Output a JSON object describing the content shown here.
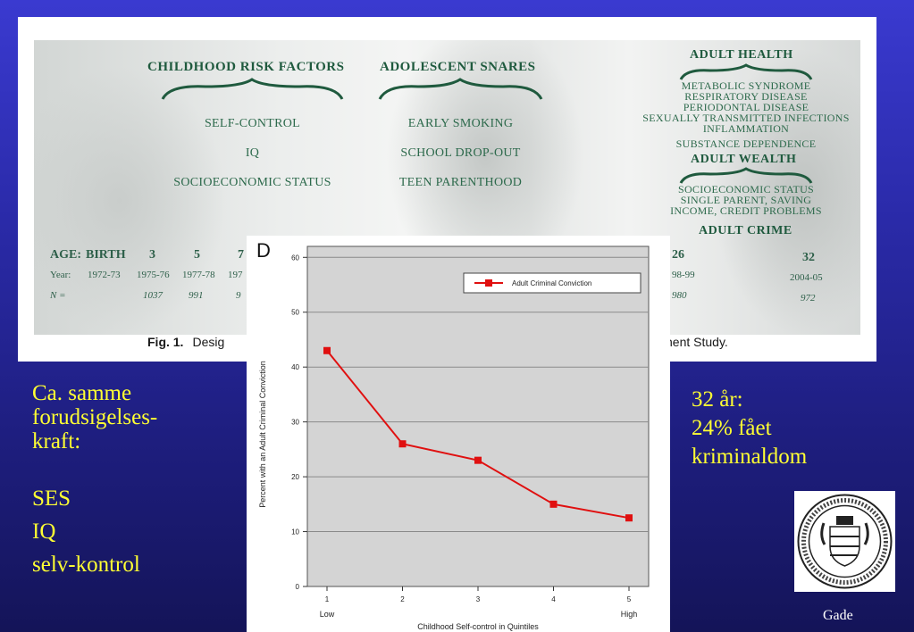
{
  "figure": {
    "childhood": {
      "header": "CHILDHOOD RISK FACTORS",
      "items": [
        "SELF-CONTROL",
        "IQ",
        "SOCIOECONOMIC STATUS"
      ]
    },
    "adolescent": {
      "header": "ADOLESCENT SNARES",
      "items": [
        "EARLY SMOKING",
        "SCHOOL DROP-OUT",
        "TEEN PARENTHOOD"
      ]
    },
    "adult_health": {
      "header": "ADULT HEALTH",
      "items": [
        "METABOLIC SYNDROME",
        "RESPIRATORY DISEASE",
        "PERIODONTAL DISEASE",
        "SEXUALLY TRANSMITTED INFECTIONS",
        "INFLAMMATION",
        "SUBSTANCE DEPENDENCE"
      ]
    },
    "adult_wealth": {
      "header": "ADULT WEALTH",
      "items": [
        "SOCIOECONOMIC STATUS",
        "SINGLE PARENT, SAVING",
        "INCOME, CREDIT PROBLEMS"
      ]
    },
    "adult_crime": {
      "header": "ADULT CRIME"
    },
    "timeline": {
      "age_label": "AGE:",
      "ages": [
        "BIRTH",
        "3",
        "5",
        "7",
        "26",
        "32"
      ],
      "year_label": "Year:",
      "years": [
        "1972-73",
        "1975-76",
        "1977-78",
        "197",
        "98-99",
        "2004-05"
      ],
      "n_label": "N =",
      "n_values": [
        "1037",
        "991",
        "9",
        "980",
        "972"
      ]
    },
    "caption_prefix": "Fig. 1.",
    "caption_start": "Desig",
    "caption_end": "nent Study."
  },
  "panel_letter": "D",
  "left_text": [
    "Ca. samme",
    "forudsigelses-",
    "kraft:",
    "",
    "SES",
    "IQ",
    "selv-kontrol"
  ],
  "right_text": [
    "32 år:",
    "24% fået",
    "kriminaldom"
  ],
  "footer_name": "Gade",
  "colors": {
    "background": "#2a2aa8",
    "highlight_text": "#ffff33",
    "series": "#e01010",
    "plot_bg": "#d4d4d4"
  },
  "chart_data": {
    "type": "line",
    "x": [
      1,
      2,
      3,
      4,
      5
    ],
    "tick_labels_x": [
      "1",
      "2",
      "3",
      "4",
      "5"
    ],
    "sub_labels_x": {
      "low": "Low",
      "high": "High"
    },
    "series": [
      {
        "name": "Adult Criminal Conviction",
        "values": [
          43,
          26,
          23,
          15,
          12.5
        ]
      }
    ],
    "ylim": [
      0,
      62
    ],
    "yticks": [
      0,
      10,
      20,
      30,
      40,
      50,
      60
    ],
    "xlabel": "Childhood Self-control in Quintiles",
    "ylabel": "Percent with an Adult Criminal Conviction",
    "grid": true,
    "legend": "top-right",
    "marker": "square"
  }
}
